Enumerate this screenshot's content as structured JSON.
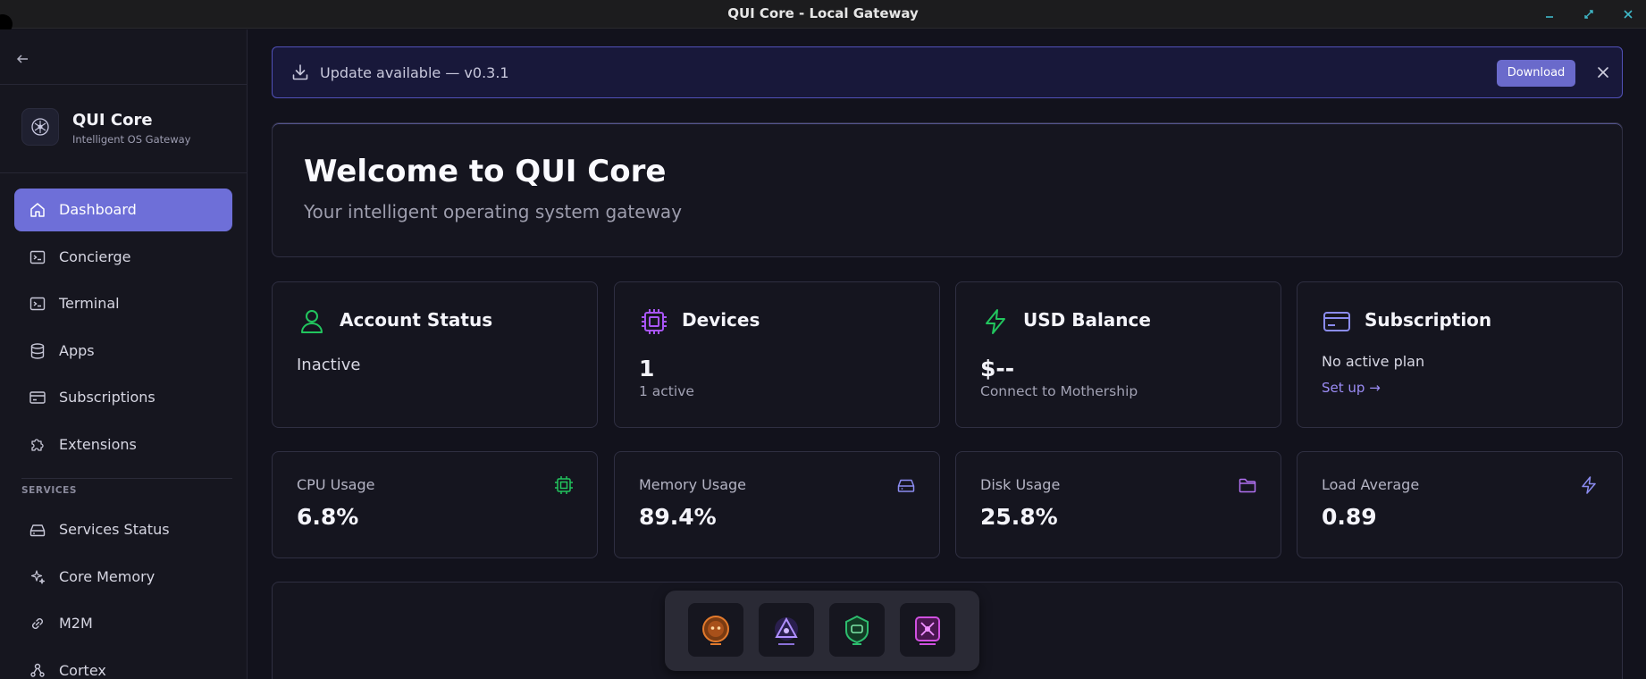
{
  "window": {
    "title": "QUI Core - Local Gateway"
  },
  "sidebar": {
    "brand_name": "QUI Core",
    "brand_sub": "Intelligent OS Gateway",
    "items": [
      {
        "label": "Dashboard",
        "icon": "home-icon",
        "active": true
      },
      {
        "label": "Concierge",
        "icon": "terminal-icon"
      },
      {
        "label": "Terminal",
        "icon": "terminal-icon"
      },
      {
        "label": "Apps",
        "icon": "database-icon"
      },
      {
        "label": "Subscriptions",
        "icon": "card-icon"
      },
      {
        "label": "Extensions",
        "icon": "puzzle-icon"
      }
    ],
    "section_label": "SERVICES",
    "services": [
      {
        "label": "Services Status",
        "icon": "drive-icon"
      },
      {
        "label": "Core Memory",
        "icon": "sparkles-icon"
      },
      {
        "label": "M2M",
        "icon": "link-icon"
      },
      {
        "label": "Cortex",
        "icon": "network-icon"
      }
    ]
  },
  "update": {
    "message": "Update available — v0.3.1",
    "button": "Download"
  },
  "hero": {
    "title": "Welcome to QUI Core",
    "subtitle": "Your intelligent operating system gateway"
  },
  "cards": {
    "account": {
      "title": "Account Status",
      "value": "Inactive"
    },
    "devices": {
      "title": "Devices",
      "value": "1",
      "sub": "1 active"
    },
    "balance": {
      "title": "USD Balance",
      "value": "$--",
      "sub": "Connect to Mothership"
    },
    "subscription": {
      "title": "Subscription",
      "value": "No active plan",
      "link": "Set up →"
    }
  },
  "metrics": [
    {
      "label": "CPU Usage",
      "value": "6.8%",
      "icon": "chip-icon",
      "color": "#22c55e"
    },
    {
      "label": "Memory Usage",
      "value": "89.4%",
      "icon": "drive-icon",
      "color": "#8b8cf0"
    },
    {
      "label": "Disk Usage",
      "value": "25.8%",
      "icon": "folder-icon",
      "color": "#b070f0"
    },
    {
      "label": "Load Average",
      "value": "0.89",
      "icon": "bolt-icon",
      "color": "#8b8cf0"
    }
  ],
  "colors": {
    "accent": "#6e6fd8",
    "green": "#22c55e",
    "purple": "#a855f7",
    "link": "#9b8cf5"
  }
}
